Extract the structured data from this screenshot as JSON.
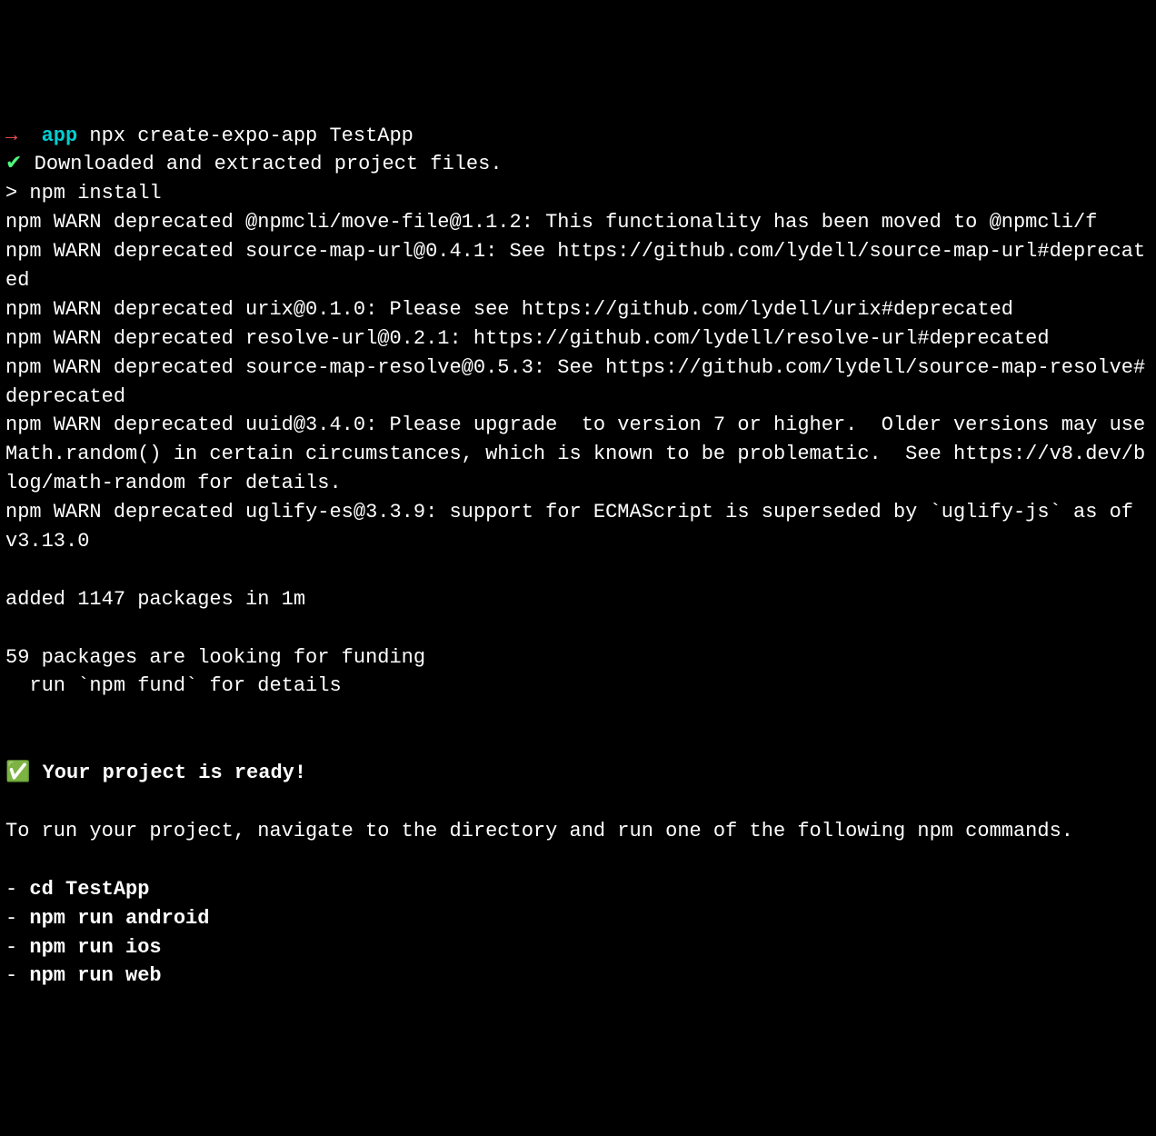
{
  "prompt": {
    "arrow": "→",
    "dir": "app",
    "command": "npx create-expo-app TestApp"
  },
  "download": {
    "check": "✔",
    "text": "Downloaded and extracted project files."
  },
  "npm_install_line": "> npm install",
  "warnings": [
    "npm WARN deprecated @npmcli/move-file@1.1.2: This functionality has been moved to @npmcli/f",
    "npm WARN deprecated source-map-url@0.4.1: See https://github.com/lydell/source-map-url#deprecated",
    "npm WARN deprecated urix@0.1.0: Please see https://github.com/lydell/urix#deprecated",
    "npm WARN deprecated resolve-url@0.2.1: https://github.com/lydell/resolve-url#deprecated",
    "npm WARN deprecated source-map-resolve@0.5.3: See https://github.com/lydell/source-map-resolve#deprecated",
    "npm WARN deprecated uuid@3.4.0: Please upgrade  to version 7 or higher.  Older versions may use Math.random() in certain circumstances, which is known to be problematic.  See https://v8.dev/blog/math-random for details.",
    "npm WARN deprecated uglify-es@3.3.9: support for ECMAScript is superseded by `uglify-js` as of v3.13.0"
  ],
  "added_line": "added 1147 packages in 1m",
  "funding_lines": [
    "59 packages are looking for funding",
    "  run `npm fund` for details"
  ],
  "ready": {
    "emoji": "✅",
    "text": "Your project is ready!"
  },
  "run_instructions": "To run your project, navigate to the directory and run one of the following npm commands.",
  "commands": [
    {
      "dash": "-",
      "cmd": "cd TestApp"
    },
    {
      "dash": "-",
      "cmd": "npm run android"
    },
    {
      "dash": "-",
      "cmd": "npm run ios"
    },
    {
      "dash": "-",
      "cmd": "npm run web"
    }
  ]
}
